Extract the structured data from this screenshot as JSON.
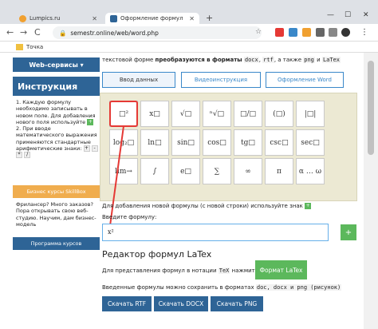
{
  "browser": {
    "tabs": [
      {
        "title": "Lumpics.ru"
      },
      {
        "title": "Оформление формул в Word о"
      }
    ],
    "new_tab": "+",
    "win": {
      "min": "—",
      "max": "☐",
      "close": "✕"
    },
    "tab_close": "✕",
    "nav": {
      "back": "←",
      "forward": "→",
      "reload": "C"
    },
    "url": "semestr.online/web/word.php",
    "bookmark": "Точка"
  },
  "sidebar": {
    "web_services": "Web-сервисы ▾",
    "instruction_title": "Инструкция",
    "step1": "1. Каждую формулу необходимо записывать в новом поле. Для добавления нового поля используйте",
    "step2": "2. При вводе математического выражения применяются стандартные арифметические знаки:",
    "ops": [
      "+",
      "-",
      "*",
      "/"
    ],
    "plus": "+",
    "skill_title": "Бизнес курсы SkillBox",
    "skill_text": "Фрилансер? Много заказов? Пора открывать свою веб-студию. Научим, дам бизнес-модель",
    "program": "Программа курсов"
  },
  "main": {
    "intro_pre": "текстовой форме",
    "intro_bold": "преобразуются в форматы",
    "intro_codes": [
      "docx",
      "rtf"
    ],
    "intro_mid": ", а также",
    "intro_codes2": [
      "png",
      "LaTex"
    ],
    "intro_and": "и",
    "tabs": [
      "Ввод данных",
      "Видеоинструкция",
      "Оформление Word"
    ],
    "keys_row1": [
      "□²",
      "x□",
      "√□",
      "ⁿ√□",
      "□/□",
      "(□)",
      "|□|",
      "log₂□"
    ],
    "keys_row2": [
      "ln□",
      "sin□",
      "cos□",
      "tg□",
      "csc□",
      "sec□",
      "lim→",
      "∫"
    ],
    "keys_row3": [
      "e□",
      "∑",
      "∞",
      "π",
      "α … ω"
    ],
    "hint": "Для добавления новой формулы (с новой строки) используйте знак",
    "input_label": "Введите формулу:",
    "input_value": "x²",
    "add_btn": "+",
    "latex_heading": "Редактор формул LaTex",
    "latex_text_pre": "Для представления формул в нотации",
    "latex_code": "TeX",
    "latex_text_post": "нажмите кнопку",
    "latex_btn": "Формат LaTex",
    "save_text_pre": "Введенные формулы можно сохранить в форматах",
    "save_formats": "doc, docx и png (рисунок)",
    "downloads": [
      "Скачать RTF",
      "Скачать DOCX",
      "Скачать PNG"
    ]
  },
  "colors": {
    "accent": "#2e6496",
    "green": "#5cb85c",
    "orange": "#f0ad4e",
    "highlight": "#e53935"
  }
}
